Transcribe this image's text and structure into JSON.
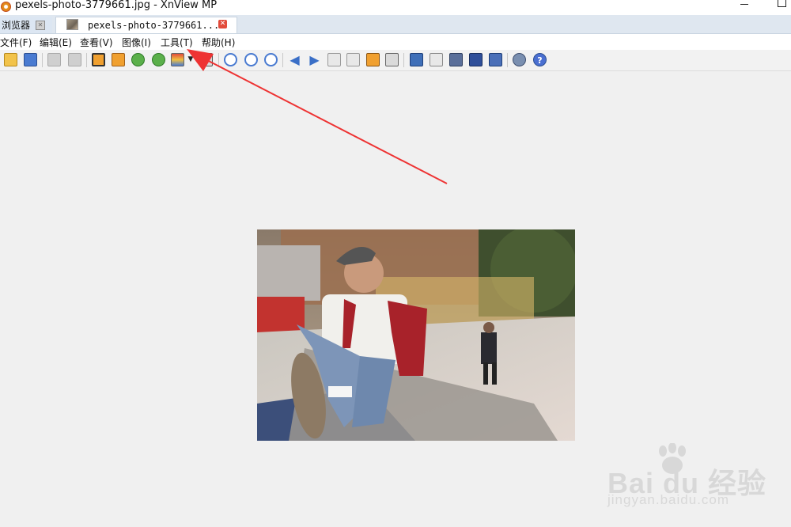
{
  "window": {
    "title": "pexels-photo-3779661.jpg - XnView MP",
    "accent": "#e24b3b"
  },
  "tabs": [
    {
      "label": "浏览器",
      "active": false
    },
    {
      "label": "pexels-photo-3779661...",
      "active": true
    }
  ],
  "menu": [
    "文件(F)",
    "编辑(E)",
    "查看(V)",
    "图像(I)",
    "工具(T)",
    "帮助(H)"
  ],
  "toolbar": {
    "buttons": [
      "browser-icon",
      "save-icon",
      "undo-icon",
      "redo-icon",
      "crop-icon",
      "resize-icon",
      "rotate-left-icon",
      "rotate-right-icon",
      "adjust-icon",
      "compare-icon",
      "zoom-in-icon",
      "zoom-fit-icon",
      "zoom-out-icon",
      "previous-icon",
      "next-icon",
      "first-icon",
      "last-icon",
      "slideshow-icon",
      "copy-icon",
      "fullscreen-icon",
      "edit-icon",
      "print-icon",
      "scan-icon",
      "capture-icon",
      "settings-icon",
      "help-icon"
    ]
  },
  "image": {
    "name": "pexels-photo-3779661.jpg"
  },
  "annotation": {
    "color": "#ee3333",
    "target": "工具(T)"
  },
  "watermark": {
    "brand": "Bai du 经验",
    "site": "jingyan.baidu.com"
  }
}
